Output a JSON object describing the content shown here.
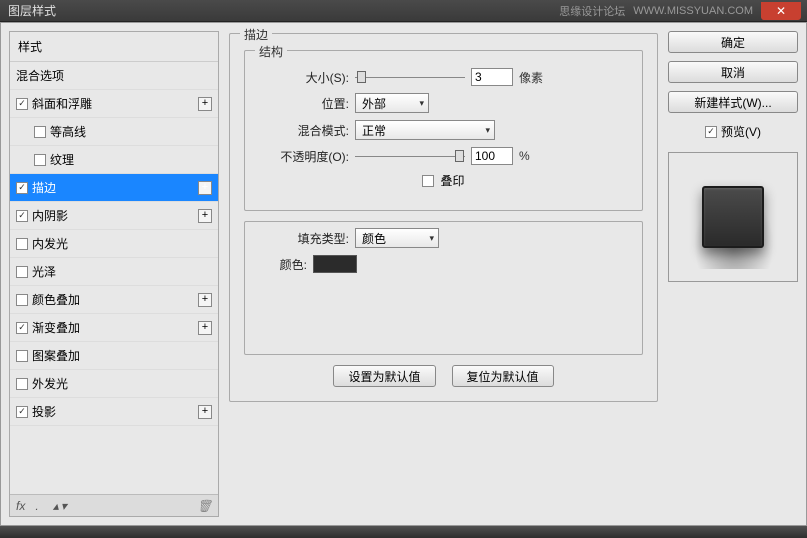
{
  "titlebar": {
    "title": "图层样式",
    "watermark1": "思缘设计论坛",
    "watermark2": "WWW.MISSYUAN.COM"
  },
  "sidebar": {
    "header": "样式",
    "blend_options": "混合选项",
    "items": [
      {
        "label": "斜面和浮雕",
        "checked": true,
        "plus": true,
        "indent": false
      },
      {
        "label": "等高线",
        "checked": false,
        "plus": false,
        "indent": true
      },
      {
        "label": "纹理",
        "checked": false,
        "plus": false,
        "indent": true
      },
      {
        "label": "描边",
        "checked": true,
        "plus": true,
        "indent": false,
        "selected": true
      },
      {
        "label": "内阴影",
        "checked": true,
        "plus": true,
        "indent": false
      },
      {
        "label": "内发光",
        "checked": false,
        "plus": false,
        "indent": false
      },
      {
        "label": "光泽",
        "checked": false,
        "plus": false,
        "indent": false
      },
      {
        "label": "颜色叠加",
        "checked": false,
        "plus": true,
        "indent": false
      },
      {
        "label": "渐变叠加",
        "checked": true,
        "plus": true,
        "indent": false
      },
      {
        "label": "图案叠加",
        "checked": false,
        "plus": false,
        "indent": false
      },
      {
        "label": "外发光",
        "checked": false,
        "plus": false,
        "indent": false
      },
      {
        "label": "投影",
        "checked": true,
        "plus": true,
        "indent": false
      }
    ],
    "footer_fx": "fx"
  },
  "main": {
    "group_title": "描边",
    "structure_title": "结构",
    "size_label": "大小(S):",
    "size_value": "3",
    "size_unit": "像素",
    "position_label": "位置:",
    "position_value": "外部",
    "blend_label": "混合模式:",
    "blend_value": "正常",
    "opacity_label": "不透明度(O):",
    "opacity_value": "100",
    "opacity_unit": "%",
    "overprint_label": "叠印",
    "filltype_label": "填充类型:",
    "filltype_value": "颜色",
    "color_label": "颜色:",
    "color_value": "#2b2b2b",
    "btn_default": "设置为默认值",
    "btn_reset": "复位为默认值"
  },
  "right": {
    "ok": "确定",
    "cancel": "取消",
    "newstyle": "新建样式(W)...",
    "preview": "预览(V)"
  }
}
